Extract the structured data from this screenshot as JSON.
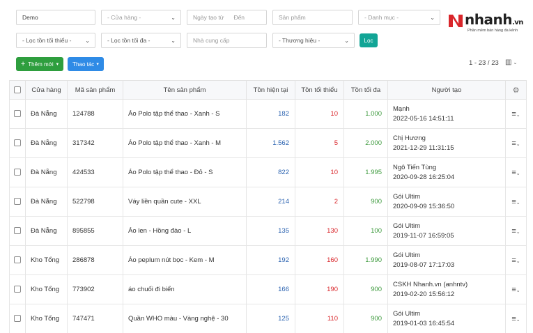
{
  "filters": {
    "store_value": "Demo",
    "store_select_placeholder": "- Cửa hàng -",
    "date_from_placeholder": "Ngày tạo từ",
    "date_to_placeholder": "Đến",
    "product_placeholder": "Sản phẩm",
    "category_placeholder": "- Danh mục -",
    "min_stock_placeholder": "- Lọc tồn tối thiểu -",
    "max_stock_placeholder": "- Lọc tồn tối đa -",
    "supplier_placeholder": "Nhà cung cấp",
    "brand_placeholder": "- Thương hiệu -",
    "filter_button": "Lọc"
  },
  "logo": {
    "brand": "nhanh",
    "domain": ".vn",
    "tagline": "Phần mềm bán hàng đa kênh"
  },
  "toolbar": {
    "add_new_label": "Thêm mới",
    "actions_label": "Thao tác",
    "pagination": "1 - 23 / 23"
  },
  "table": {
    "columns": [
      "Cửa hàng",
      "Mã sản phẩm",
      "Tên sản phẩm",
      "Tồn hiện tại",
      "Tồn tối thiểu",
      "Tồn tối đa",
      "Người tạo"
    ],
    "rows": [
      {
        "store": "Đà Nẵng",
        "code": "124788",
        "name": "Áo Polo tập thể thao - Xanh - S",
        "current": "182",
        "min": "10",
        "max": "1.000",
        "creator": "Mạnh",
        "created": "2022-05-16 14:51:11"
      },
      {
        "store": "Đà Nẵng",
        "code": "317342",
        "name": "Áo Polo tập thể thao - Xanh - M",
        "current": "1.562",
        "min": "5",
        "max": "2.000",
        "creator": "Chị Hương",
        "created": "2021-12-29 11:31:15"
      },
      {
        "store": "Đà Nẵng",
        "code": "424533",
        "name": "Áo Polo tập thể thao - Đỏ - S",
        "current": "822",
        "min": "10",
        "max": "1.995",
        "creator": "Ngô Tiến Tùng",
        "created": "2020-09-28 16:25:04"
      },
      {
        "store": "Đà Nẵng",
        "code": "522798",
        "name": "Váy liền quần cute - XXL",
        "current": "214",
        "min": "2",
        "max": "900",
        "creator": "Gói Ultim",
        "created": "2020-09-09 15:36:50"
      },
      {
        "store": "Đà Nẵng",
        "code": "895855",
        "name": "Áo len - Hồng đào - L",
        "current": "135",
        "min": "130",
        "max": "100",
        "creator": "Gói Ultim",
        "created": "2019-11-07 16:59:05"
      },
      {
        "store": "Kho Tổng",
        "code": "286878",
        "name": "Áo peplum nút bọc - Kem - M",
        "current": "192",
        "min": "160",
        "max": "1.990",
        "creator": "Gói Ultim",
        "created": "2019-08-07 17:17:03"
      },
      {
        "store": "Kho Tổng",
        "code": "773902",
        "name": "áo chuối đi biển",
        "current": "166",
        "min": "190",
        "max": "900",
        "creator": "CSKH Nhanh.vn (anhntv)",
        "created": "2019-02-20 15:56:12"
      },
      {
        "store": "Kho Tổng",
        "code": "747471",
        "name": "Quần WHO màu - Vàng nghệ - 30",
        "current": "125",
        "min": "110",
        "max": "900",
        "creator": "Gói Ultim",
        "created": "2019-01-03 16:45:54"
      }
    ]
  },
  "colors": {
    "green_button": "#2e9e3e",
    "blue_button": "#2f8be6",
    "filter_button": "#12a596",
    "current_stock": "#2a62b0",
    "min_stock": "#d9262b",
    "max_stock": "#3d9a3d"
  },
  "icons": {
    "add": "plus-icon",
    "dropdown": "chevron-down-icon",
    "settings": "gear-icon",
    "row_menu": "hamburger-icon",
    "columns": "columns-icon"
  }
}
